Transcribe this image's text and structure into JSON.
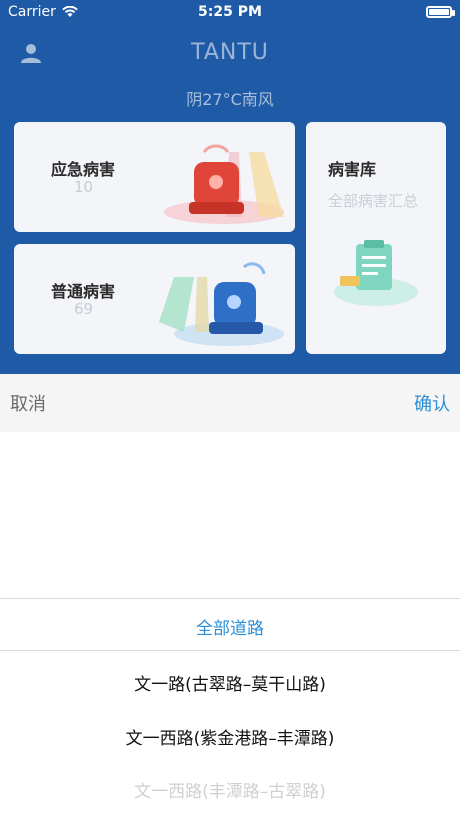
{
  "status_bar": {
    "carrier": "Carrier",
    "time": "5:25 PM"
  },
  "header": {
    "title": "TANTU",
    "weather": "阴27°C南风"
  },
  "cards": {
    "emergency": {
      "title": "应急病害",
      "count": "10"
    },
    "normal": {
      "title": "普通病害",
      "count": "69"
    },
    "library": {
      "title": "病害库",
      "subtitle": "全部病害汇总"
    }
  },
  "picker": {
    "cancel_label": "取消",
    "confirm_label": "确认",
    "options": [
      "全部道路",
      "文一路(古翠路–莫干山路)",
      "文一西路(紫金港路–丰潭路)",
      "文一西路(丰潭路–古翠路)"
    ],
    "selected_index": 0
  },
  "colors": {
    "brand_blue": "#1f5aa6",
    "accent_blue": "#2a8fd8"
  }
}
